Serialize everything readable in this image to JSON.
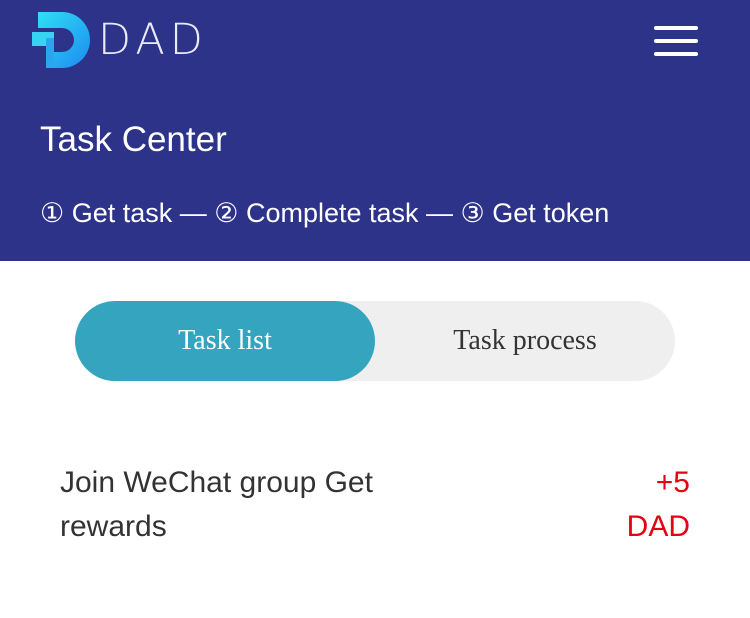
{
  "app": {
    "logo_text": "DAD"
  },
  "header": {
    "title": "Task Center",
    "steps": "① Get task — ② Complete task — ③ Get token"
  },
  "tabs": [
    {
      "label": "Task list",
      "active": true
    },
    {
      "label": "Task process",
      "active": false
    }
  ],
  "tasks": [
    {
      "name": "Join WeChat group Get rewards",
      "reward_amount": "+5",
      "reward_unit": "DAD"
    }
  ],
  "colors": {
    "header_bg": "#2d3389",
    "tab_active": "#34a4bf",
    "reward": "#e60012"
  },
  "icons": {
    "menu": "hamburger-menu-icon",
    "logo": "dad-logo-icon"
  }
}
